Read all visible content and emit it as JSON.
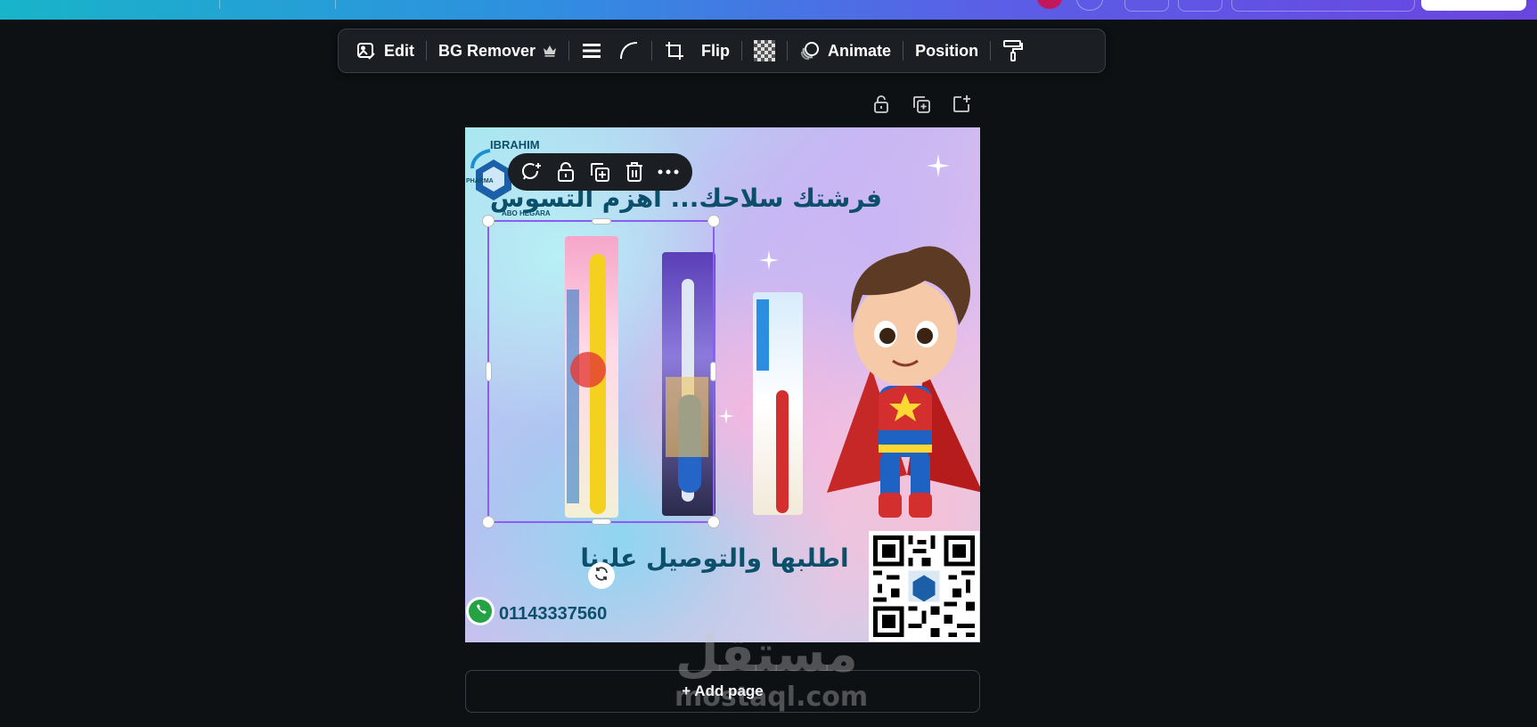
{
  "toolbar": {
    "edit_label": "Edit",
    "bg_remover_label": "BG Remover",
    "flip_label": "Flip",
    "animate_label": "Animate",
    "position_label": "Position",
    "icons": [
      "edit-image-icon",
      "crown-icon",
      "border-lines-icon",
      "corner-rounding-icon",
      "crop-icon",
      "transparency-icon",
      "animate-icon",
      "paint-roller-icon"
    ]
  },
  "page_actions": {
    "icons": [
      "lock-page-icon",
      "duplicate-page-icon",
      "add-page-icon"
    ]
  },
  "context_menu": {
    "icons": [
      "comment-icon",
      "lock-icon",
      "duplicate-icon",
      "trash-icon",
      "more-icon"
    ]
  },
  "design": {
    "headline": "فرشتك سلاحك... اهزم التسوس",
    "subline": "اطلبها والتوصيل علينا",
    "phone": "01143337560",
    "logo_top": "IBRAHIM",
    "logo_bottom": "ABO HEGARA",
    "logo_side": "PHARMA"
  },
  "footer": {
    "add_page_label": "+ Add page"
  },
  "watermark": {
    "arabic": "مستقل",
    "latin": "mostaql.com"
  },
  "colors": {
    "selection": "#8b5cf6",
    "toolbar_bg": "#1b1e22",
    "canvas_bg": "#0e1114",
    "text_dark_teal": "#0c4f6a"
  }
}
